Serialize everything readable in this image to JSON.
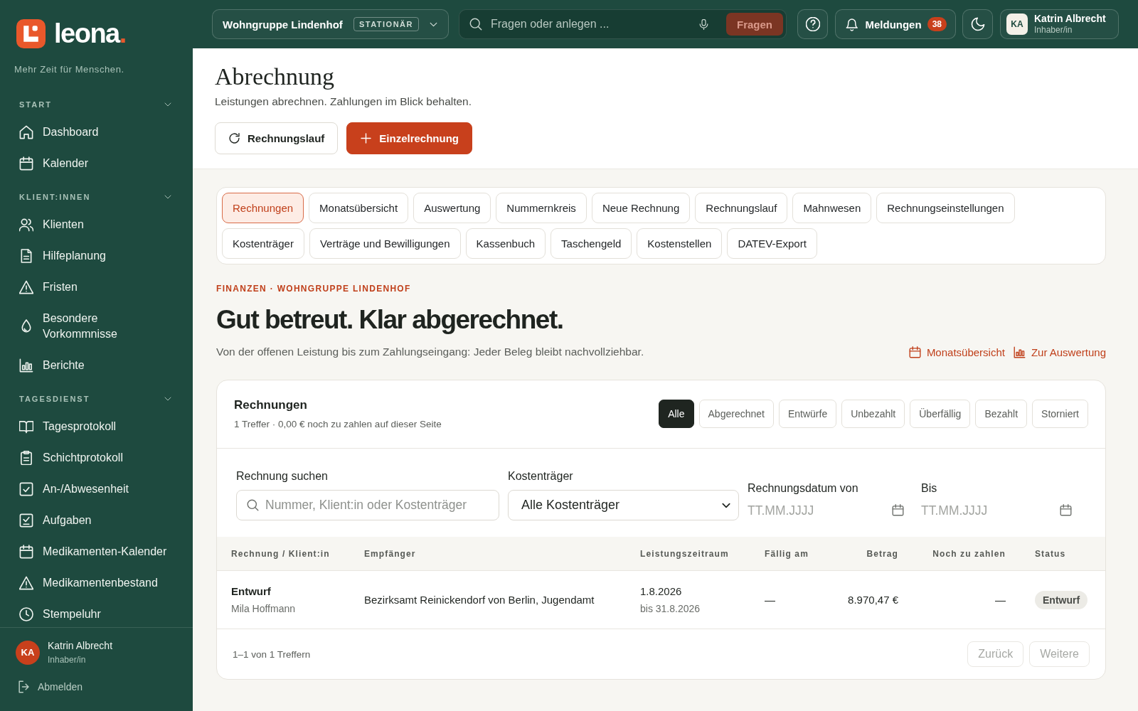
{
  "sidebar": {
    "logo": {
      "text": "leona",
      "dot": "."
    },
    "tagline": "Mehr Zeit für Menschen.",
    "sections": [
      {
        "title": "START",
        "expanded": true,
        "items": [
          {
            "label": "Dashboard",
            "selected": false
          },
          {
            "label": "Kalender",
            "selected": false
          }
        ]
      },
      {
        "title": "KLIENT:INNEN",
        "expanded": true,
        "items": [
          {
            "label": "Klienten",
            "selected": false
          },
          {
            "label": "Hilfeplanung",
            "selected": false
          },
          {
            "label": "Fristen",
            "selected": false
          },
          {
            "label": "Besondere Vorkommnisse",
            "selected": false
          },
          {
            "label": "Berichte",
            "selected": false
          }
        ]
      },
      {
        "title": "TAGESDIENST",
        "expanded": true,
        "items": [
          {
            "label": "Tagesprotokoll",
            "selected": false
          },
          {
            "label": "Schichtprotokoll",
            "selected": false
          },
          {
            "label": "An-/Abwesenheit",
            "selected": false
          },
          {
            "label": "Aufgaben",
            "selected": false
          },
          {
            "label": "Medikamenten-Kalender",
            "selected": false
          },
          {
            "label": "Medikamentenbestand",
            "selected": false
          },
          {
            "label": "Stempeluhr",
            "selected": false
          }
        ]
      }
    ],
    "user": {
      "initials": "KA",
      "name": "Katrin Albrecht",
      "role": "Inhaber/in"
    },
    "logout": "Abmelden"
  },
  "topbar": {
    "facility": {
      "name": "Wohngruppe Lindenhof",
      "badge": "STATIONÄR"
    },
    "search": {
      "placeholder": "Fragen oder anlegen ...",
      "button": {
        "label": "Fragen",
        "disabled": true
      }
    },
    "notifications": {
      "label": "Meldungen",
      "count": "38"
    },
    "user": {
      "initials": "KA",
      "name": "Katrin Albrecht",
      "role": "Inhaber/in"
    }
  },
  "header": {
    "title": "Abrechnung",
    "subtitle": "Leistungen abrechnen. Zahlungen im Blick behalten.",
    "actions": [
      {
        "label": "Rechnungslauf",
        "kind": "secondary"
      },
      {
        "label": "Einzelrechnung",
        "kind": "primary"
      }
    ]
  },
  "tab_rows": [
    [
      {
        "label": "Rechnungen",
        "selected": true
      },
      {
        "label": "Monatsübersicht",
        "selected": false
      },
      {
        "label": "Auswertung",
        "selected": false
      },
      {
        "label": "Nummernkreis",
        "selected": false
      },
      {
        "label": "Neue Rechnung",
        "selected": false
      },
      {
        "label": "Rechnungslauf",
        "selected": false
      },
      {
        "label": "Mahnwesen",
        "selected": false
      },
      {
        "label": "Rechnungseinstellungen",
        "selected": false
      }
    ],
    [
      {
        "label": "Kostenträger",
        "selected": false
      },
      {
        "label": "Verträge und Bewilligungen",
        "selected": false
      },
      {
        "label": "Kassenbuch",
        "selected": false
      },
      {
        "label": "Taschengeld",
        "selected": false
      },
      {
        "label": "Kostenstellen",
        "selected": false
      },
      {
        "label": "DATEV-Export",
        "selected": false
      }
    ]
  ],
  "intro": {
    "eyebrow": "FINANZEN · WOHNGRUPPE LINDENHOF",
    "title": "Gut betreut. Klar abgerechnet.",
    "text": "Von der offenen Leistung bis zum Zahlungseingang: Jeder Beleg bleibt nachvollziehbar.",
    "links": [
      "Monatsübersicht",
      "Zur Auswertung"
    ]
  },
  "invoices": {
    "title": "Rechnungen",
    "summary": "1 Treffer · 0,00 € noch zu zahlen auf dieser Seite",
    "filters": [
      {
        "label": "Alle",
        "selected": true
      },
      {
        "label": "Abgerechnet",
        "selected": false
      },
      {
        "label": "Entwürfe",
        "selected": false
      },
      {
        "label": "Unbezahlt",
        "selected": false
      },
      {
        "label": "Überfällig",
        "selected": false
      },
      {
        "label": "Bezahlt",
        "selected": false
      },
      {
        "label": "Storniert",
        "selected": false
      }
    ],
    "search": {
      "label": "Rechnung suchen",
      "placeholder": "Nummer, Klient:in oder Kostenträger"
    },
    "payer": {
      "label": "Kostenträger",
      "value": "Alle Kostenträger"
    },
    "date_from": {
      "label": "Rechnungsdatum von",
      "placeholder": "TT.MM.JJJJ"
    },
    "date_to": {
      "label": "Bis",
      "placeholder": "TT.MM.JJJJ"
    },
    "table": {
      "columns": [
        "Rechnung / Klient:in",
        "Empfänger",
        "Leistungszeitraum",
        "Fällig am",
        "Betrag",
        "Noch zu zahlen",
        "Status"
      ],
      "rows": [
        {
          "invoice": "Entwurf",
          "client": "Mila Hoffmann",
          "recipient": "Bezirksamt Reinickendorf von Berlin, Jugendamt",
          "period": "1.8.2026",
          "period_end": "bis 31.8.2026",
          "due": "—",
          "amount": "8.970,47 €",
          "outstanding": "—",
          "status": "Entwurf"
        }
      ]
    },
    "pagination": {
      "range": "1–1 von 1 Treffern",
      "buttons": [
        {
          "label": "Zurück",
          "disabled": true
        },
        {
          "label": "Weitere",
          "disabled": true
        }
      ]
    }
  }
}
